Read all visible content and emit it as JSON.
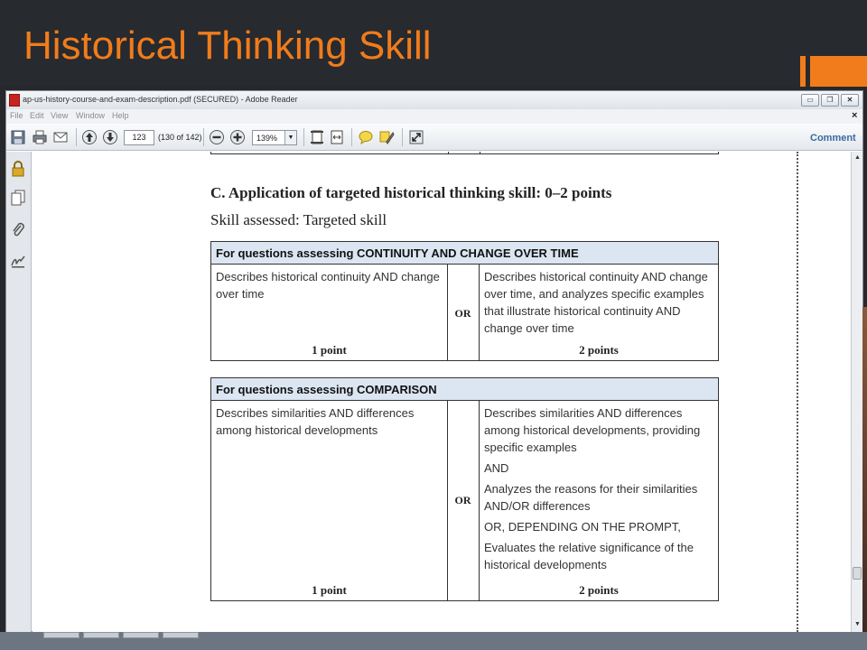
{
  "slide": {
    "title": "Historical Thinking Skill",
    "accent_color": "#f07c1c"
  },
  "window": {
    "title": "ap-us-history-course-and-exam-description.pdf (SECURED) - Adobe Reader",
    "app_icon": "pdf-icon",
    "buttons": [
      "minimize-icon",
      "restore-icon",
      "close-icon"
    ]
  },
  "menu": {
    "items": [
      "File",
      "Edit",
      "View",
      "Window",
      "Help"
    ],
    "close_glyph": "×"
  },
  "toolbar": {
    "icons": [
      "save-icon",
      "print-icon",
      "email-icon",
      "page-up-icon",
      "page-down-icon",
      "zoom-out-icon",
      "zoom-in-icon",
      "fit-page-icon",
      "fit-width-icon",
      "comment-icon",
      "highlight-icon",
      "fullscreen-icon"
    ],
    "page_number": "123",
    "page_count": "(130 of 142)",
    "zoom": "139%",
    "comment_label": "Comment"
  },
  "left_panel": {
    "icons": [
      "lock-icon",
      "pages-icon",
      "attachment-icon",
      "signature-icon"
    ]
  },
  "document": {
    "heading": "C. Application of targeted historical thinking skill: 0–2 points",
    "subheading": "Skill assessed: Targeted skill",
    "tables": [
      {
        "header_prefix": "For questions assessing ",
        "header_topic": "CONTINUITY AND CHANGE OVER TIME",
        "left": [
          "Describes historical continuity AND change over time"
        ],
        "or_label": "OR",
        "right": [
          "Describes historical continuity AND change over time, and analyzes specific examples that illustrate historical continuity AND change over time"
        ],
        "left_points": "1 point",
        "right_points": "2 points"
      },
      {
        "header_prefix": "For questions assessing ",
        "header_topic": "COMPARISON",
        "left": [
          "Describes similarities AND differences among historical developments"
        ],
        "or_label": "OR",
        "right": [
          "Describes similarities AND differences among historical developments, providing specific examples",
          "AND",
          "Analyzes the reasons for their similarities AND/OR differences",
          "OR, DEPENDING ON THE PROMPT,",
          "Evaluates the relative significance of the historical developments"
        ],
        "left_points": "1 point",
        "right_points": "2 points"
      }
    ]
  }
}
